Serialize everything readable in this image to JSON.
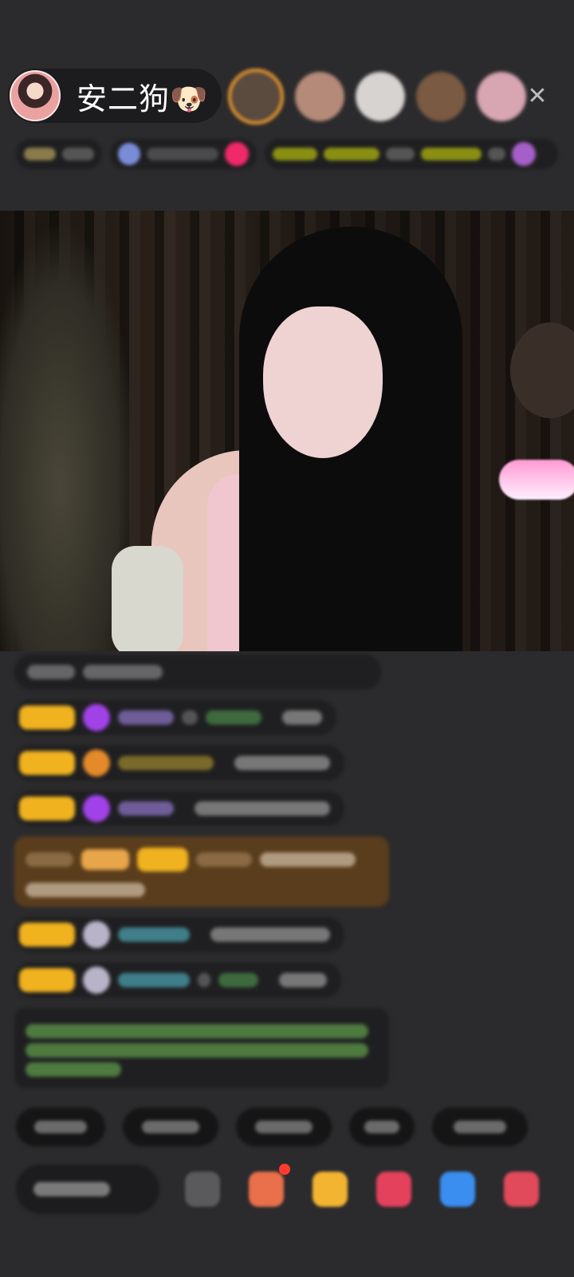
{
  "header": {
    "host_name": "安二狗🐶",
    "close_glyph": "✕"
  },
  "colors": {
    "background": "#2b2b2d",
    "badge_gold": "#f0b21f",
    "gem_purple": "#a142e8",
    "brown_message": "#5a3d1c",
    "accent_red": "#ff3b30"
  },
  "icons": {
    "host_avatar": "host-avatar",
    "close": "close-icon",
    "gift_box": "gift-box-icon",
    "emoji": "emoji-icon"
  }
}
